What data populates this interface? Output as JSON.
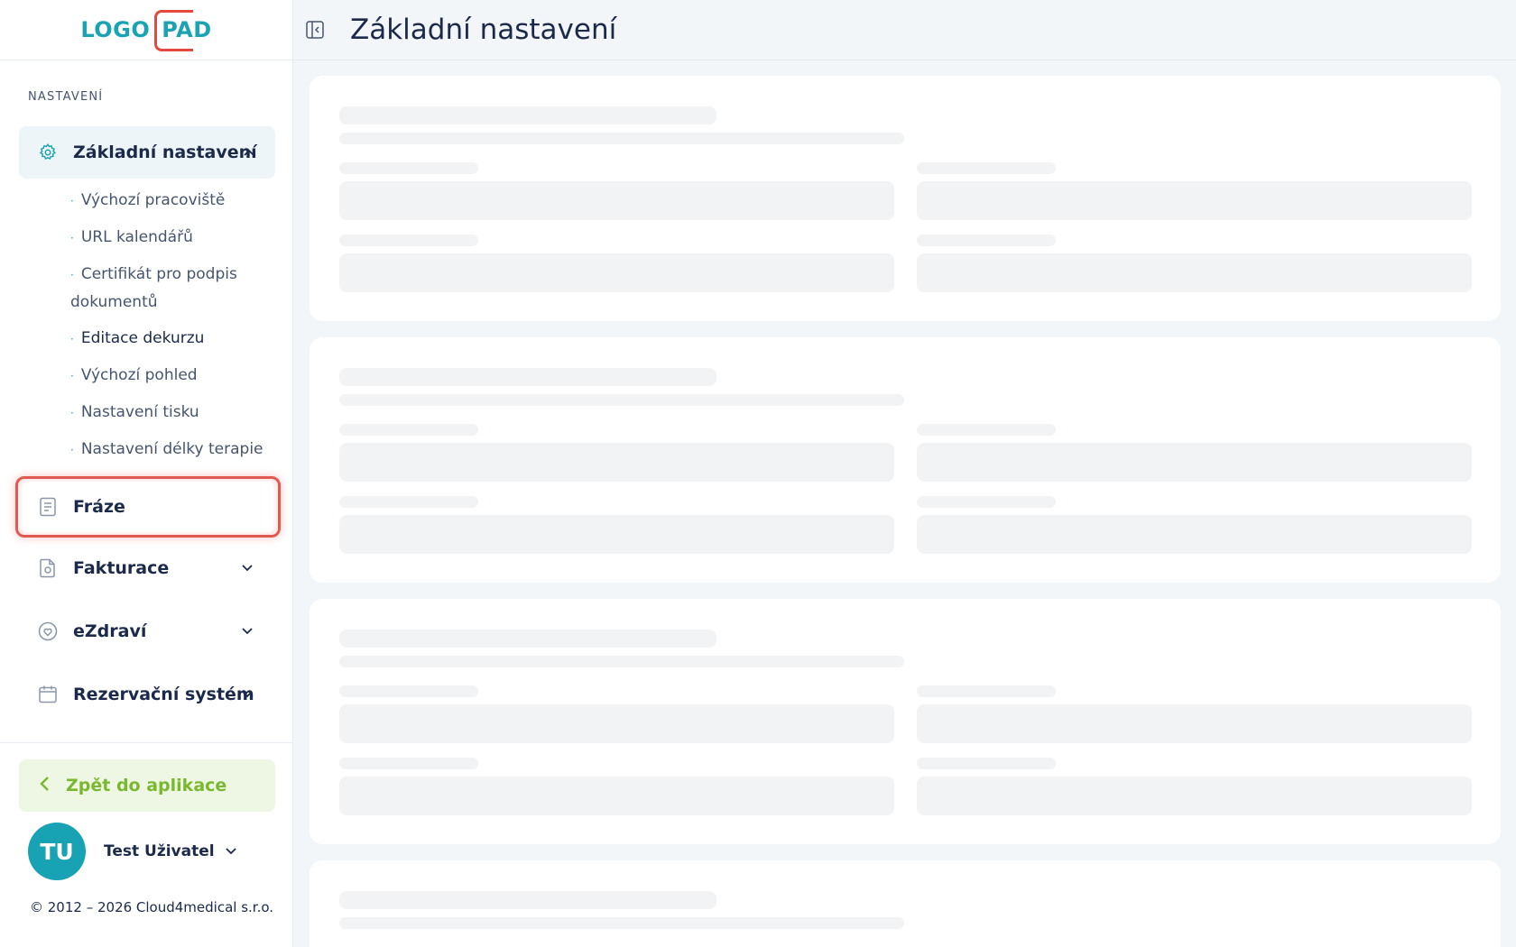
{
  "app": {
    "logo_left": "LOGO",
    "logo_right": "PAD"
  },
  "header": {
    "title": "Základní nastavení"
  },
  "sidebar": {
    "section_label": "NASTAVENÍ",
    "main_item": {
      "label": "Základní nastavení",
      "icon": "gear-icon",
      "expanded": true
    },
    "sub_items": [
      {
        "label": "Výchozí pracoviště"
      },
      {
        "label": "URL kalendářů"
      },
      {
        "label": "Certifikát pro podpis dokumentů"
      },
      {
        "label": "Editace dekurzu"
      },
      {
        "label": "Výchozí pohled"
      },
      {
        "label": "Nastavení tisku"
      },
      {
        "label": "Nastavení délky terapie"
      }
    ],
    "items": [
      {
        "label": "Fráze",
        "icon": "document-icon"
      },
      {
        "label": "Fakturace",
        "icon": "invoice-icon"
      },
      {
        "label": "eZdraví",
        "icon": "heart-icon"
      },
      {
        "label": "Rezervační systém",
        "icon": "calendar-icon"
      }
    ],
    "back_button": "Zpět do aplikace",
    "user": {
      "initials": "TU",
      "name": "Test Uživatel"
    },
    "copyright": "© 2012 – 2026 Cloud4medical s.r.o."
  },
  "colors": {
    "accent": "#1aa3b3",
    "highlight": "#e05a52",
    "back_green": "#7ab92f"
  }
}
